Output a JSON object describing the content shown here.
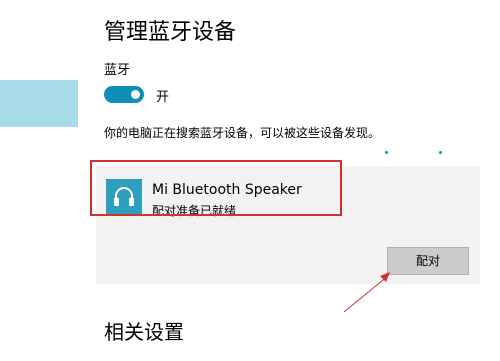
{
  "header": {
    "title": "管理蓝牙设备"
  },
  "bluetooth": {
    "label": "蓝牙",
    "state": "开",
    "search_message": "你的电脑正在搜索蓝牙设备，可以被这些设备发现。"
  },
  "device": {
    "name": "Mi Bluetooth Speaker",
    "status": "配对准备已就绪",
    "icon": "headphones-icon",
    "pair_label": "配对"
  },
  "related": {
    "title": "相关设置"
  },
  "colors": {
    "accent": "#0f8fb8",
    "highlight": "#d0312d",
    "device_icon_bg": "#2e9fbd",
    "sidebar_selected": "#a7dbe8"
  }
}
